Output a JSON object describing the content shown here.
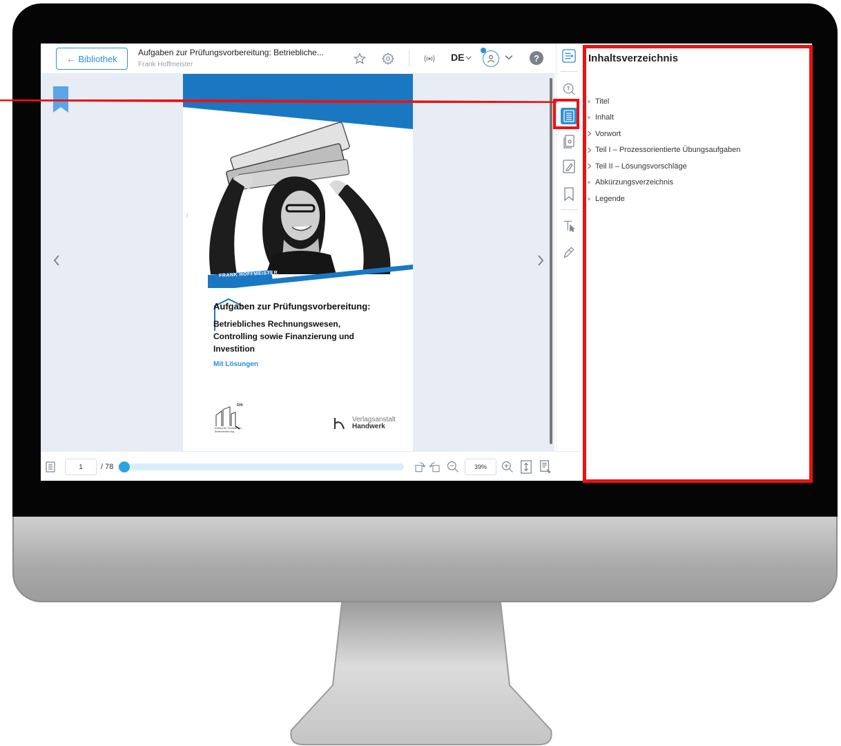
{
  "header": {
    "back_label": "Bibliothek",
    "doc_title": "Aufgaben zur Prüfungsvorbereitung: Betriebliche...",
    "doc_author": "Frank Hoffmeister",
    "language": "DE",
    "help_label": "?"
  },
  "cover": {
    "author": "FRANK HOFFMEISTER",
    "title_main": "Aufgaben zur Prüfungsvorbereitung:",
    "title_sub": "Betriebliches Rechnungswesen, Controlling sowie Finanzierung und Investition",
    "extra": "Mit Lösungen",
    "dhi_label": "Institut für Technik der Betriebsführung",
    "dhi_mark": "DHI",
    "publisher_top": "Verlagsanstalt",
    "publisher_bottom": "Handwerk"
  },
  "pagination": {
    "current_page": "1",
    "total_pages": "/ 78",
    "progress": 0.0128,
    "zoom": "39%"
  },
  "toc": {
    "heading": "Inhaltsverzeichnis",
    "items": [
      {
        "label": "Titel",
        "expandable": false
      },
      {
        "label": "Inhalt",
        "expandable": false
      },
      {
        "label": "Vorwort",
        "expandable": true
      },
      {
        "label": "Teil I – Prozessorientierte Übungsaufgaben",
        "expandable": true
      },
      {
        "label": "Teil II – Lösungsvorschläge",
        "expandable": true
      },
      {
        "label": "Abkürzungsverzeichnis",
        "expandable": false
      },
      {
        "label": "Legende",
        "expandable": false
      }
    ]
  },
  "colors": {
    "accent": "#2d8fd5",
    "highlight": "#ee1111",
    "doc_background": "#e8ecf4"
  },
  "icons": {
    "tools": [
      "collapse-panel-icon",
      "search-icon",
      "table-of-contents-icon",
      "page-thumbnails-icon",
      "notes-icon",
      "bookmarks-icon",
      "text-select-icon",
      "pen-icon"
    ]
  }
}
